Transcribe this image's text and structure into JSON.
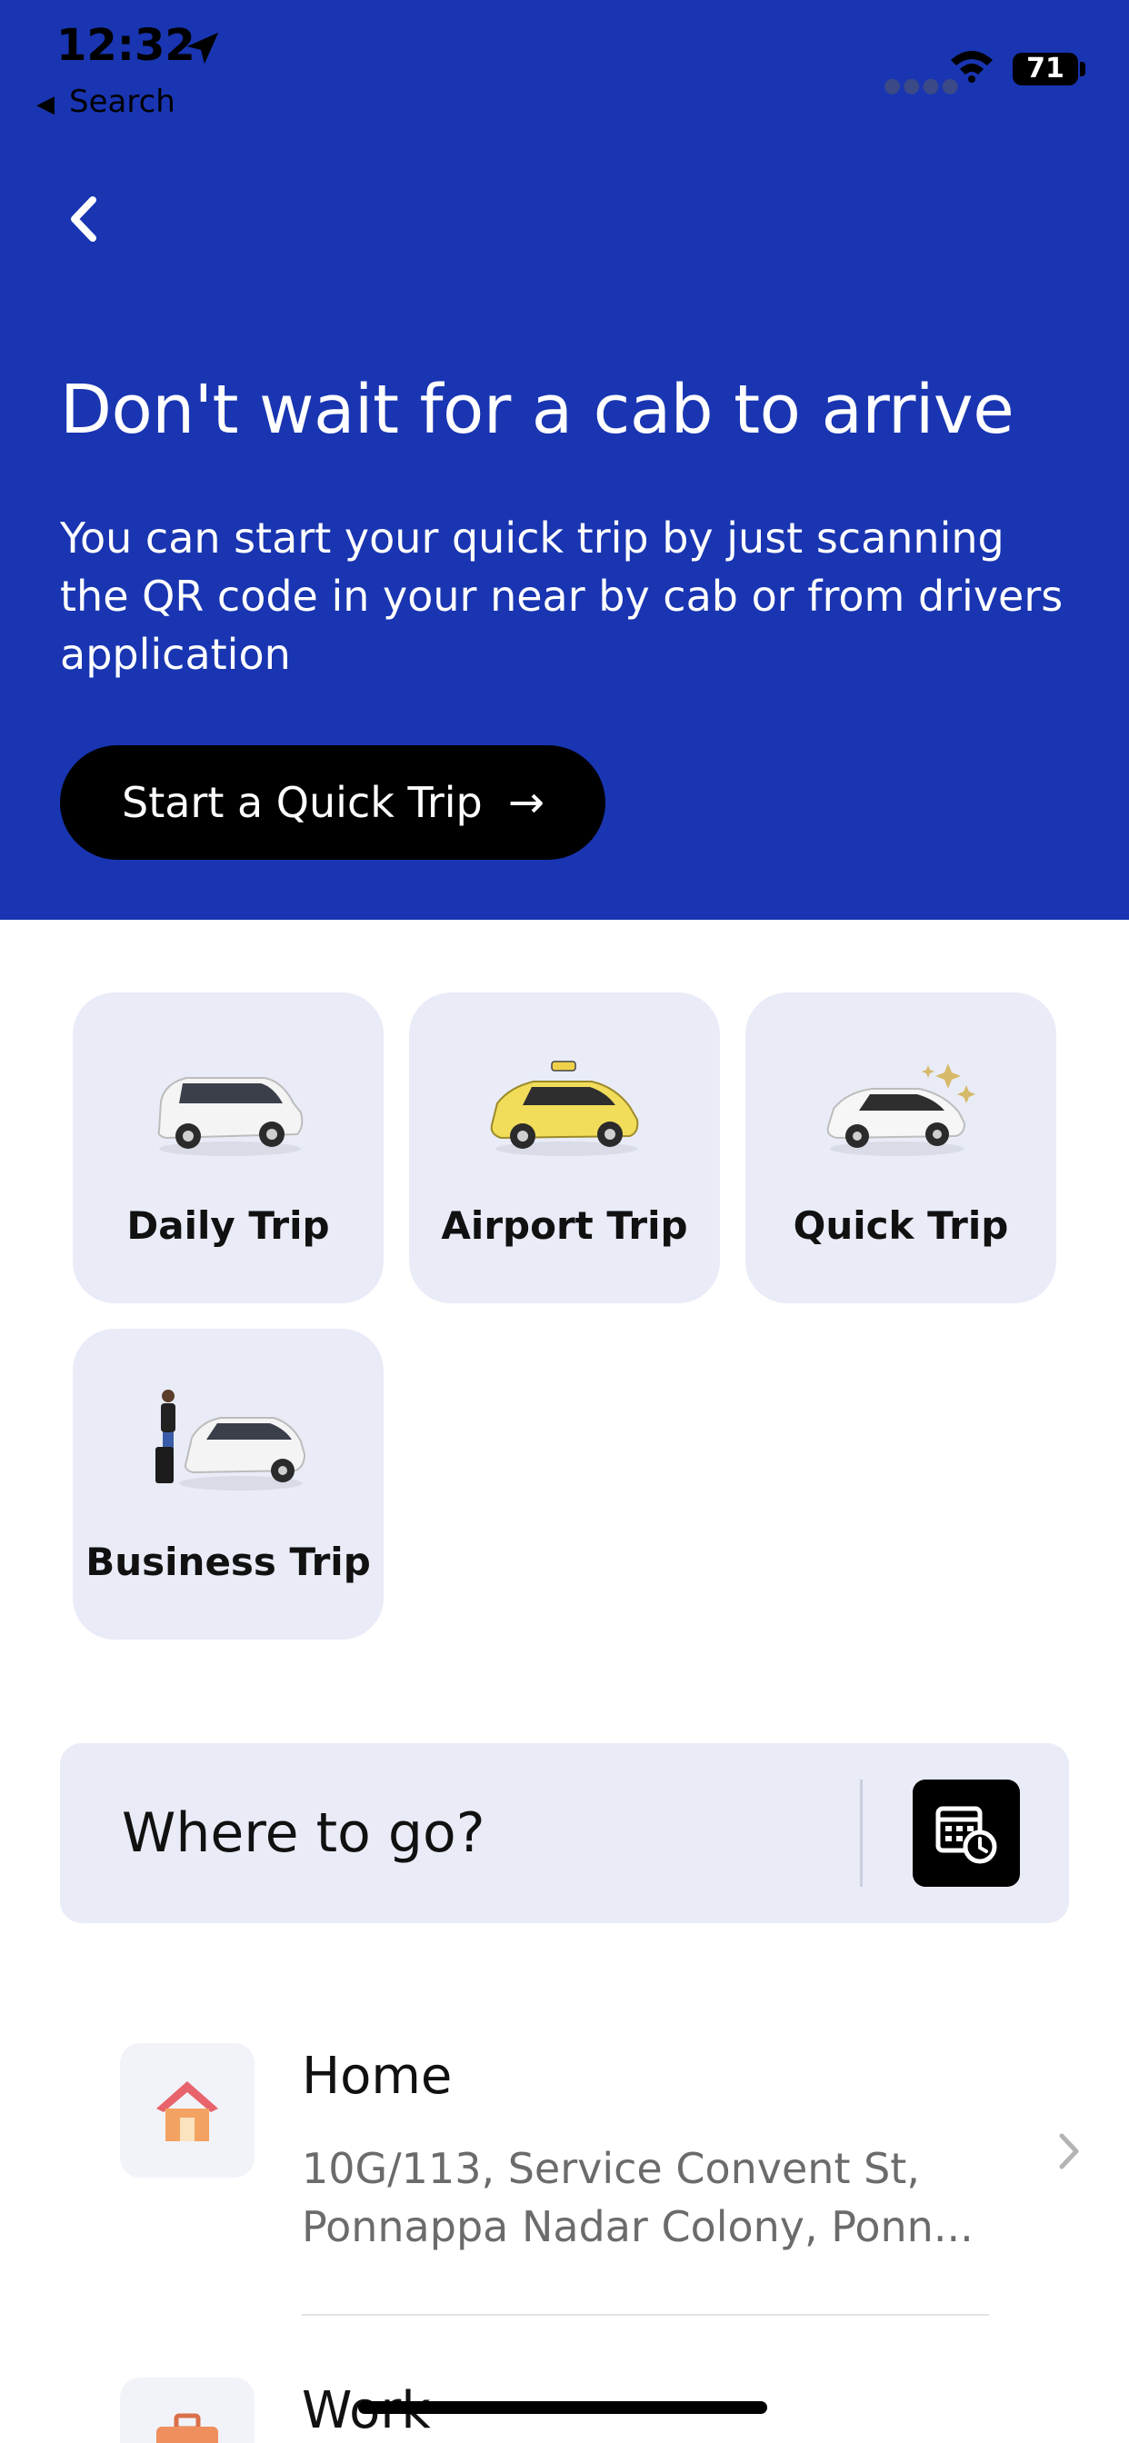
{
  "status_bar": {
    "time": "12:32",
    "back_to_app": "Search",
    "battery": "71"
  },
  "hero": {
    "title": "Don't wait for a cab to arrive",
    "subtitle": "You can start your quick trip by just scanning the QR code in your near by cab or from drivers application",
    "cta_label": "Start a Quick Trip",
    "cta_arrow": "→",
    "background_color": "#1935b1"
  },
  "trip_types": [
    {
      "label": "Daily Trip",
      "icon": "white-minivan-icon"
    },
    {
      "label": "Airport Trip",
      "icon": "yellow-taxi-icon"
    },
    {
      "label": "Quick Trip",
      "icon": "sparkling-white-car-icon"
    },
    {
      "label": "Business Trip",
      "icon": "traveler-with-car-icon"
    }
  ],
  "search": {
    "placeholder": "Where to go?",
    "schedule_icon": "calendar-clock-icon"
  },
  "saved_places": [
    {
      "title": "Home",
      "address_line1": "10G/113, Service Convent St,",
      "address_line2": "Ponnappa Nadar Colony, Ponn...",
      "icon": "house-icon"
    },
    {
      "title": "Work",
      "icon": "briefcase-icon"
    }
  ]
}
